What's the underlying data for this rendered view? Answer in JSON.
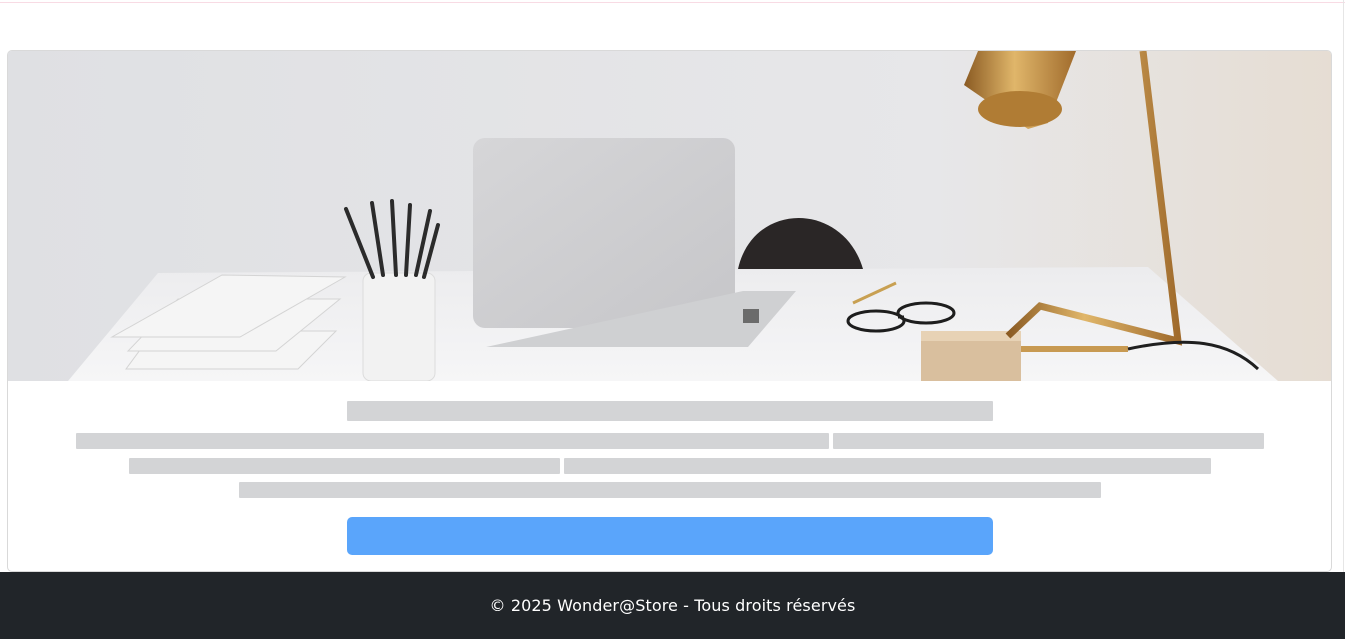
{
  "footer": {
    "copyright": "© 2025 Wonder@Store - Tous droits réservés"
  },
  "hero": {
    "image_icon": "workspace-desk-photo"
  },
  "skeleton": {
    "state": "loading"
  },
  "colors": {
    "footer_bg": "#212529",
    "cta_bg": "#5aa5fb",
    "skeleton": "#d3d4d6"
  }
}
